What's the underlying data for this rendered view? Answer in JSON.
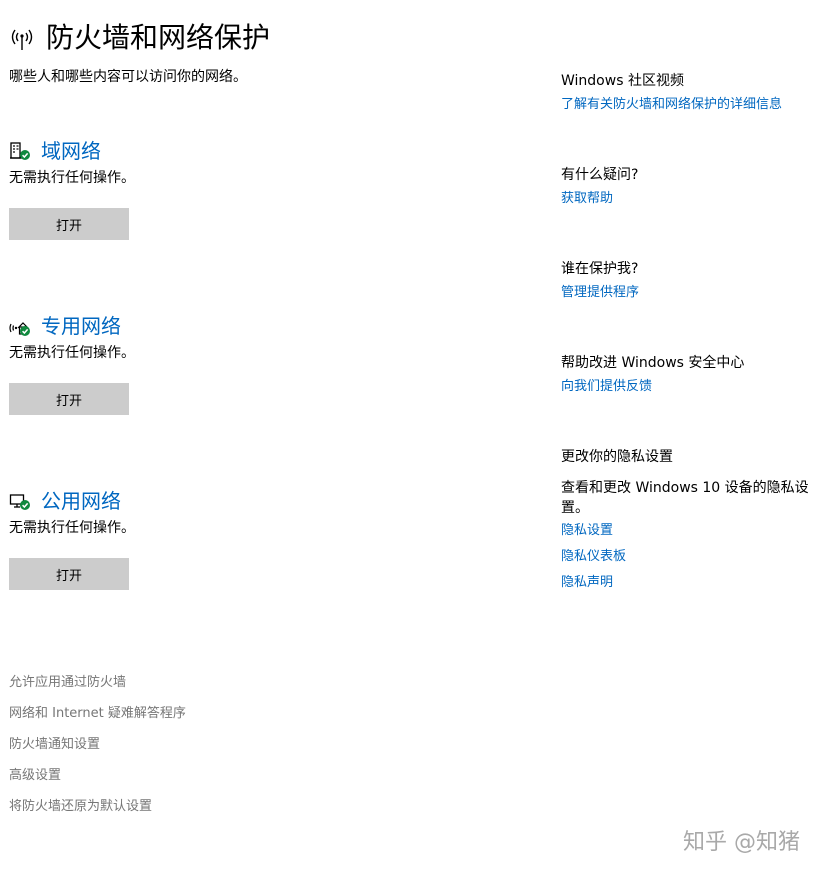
{
  "header": {
    "title": "防火墙和网络保护",
    "subtitle": "哪些人和哪些内容可以访问你的网络。",
    "icon": "wifi-antenna-icon"
  },
  "networks": [
    {
      "name": "域网络",
      "status": "无需执行任何操作。",
      "button_label": "打开",
      "icon": "domain-network-icon"
    },
    {
      "name": "专用网络",
      "status": "无需执行任何操作。",
      "button_label": "打开",
      "icon": "private-network-icon"
    },
    {
      "name": "公用网络",
      "status": "无需执行任何操作。",
      "button_label": "打开",
      "icon": "public-network-icon"
    }
  ],
  "footer_links": [
    "允许应用通过防火墙",
    "网络和 Internet 疑难解答程序",
    "防火墙通知设置",
    "高级设置",
    "将防火墙还原为默认设置"
  ],
  "sidebar": {
    "community": {
      "heading": "Windows 社区视频",
      "link": "了解有关防火墙和网络保护的详细信息"
    },
    "help": {
      "heading": "有什么疑问?",
      "link": "获取帮助"
    },
    "protector": {
      "heading": "谁在保护我?",
      "link": "管理提供程序"
    },
    "feedback": {
      "heading": "帮助改进 Windows 安全中心",
      "link": "向我们提供反馈"
    },
    "privacy": {
      "heading": "更改你的隐私设置",
      "text": "查看和更改 Windows 10 设备的隐私设置。",
      "links": [
        "隐私设置",
        "隐私仪表板",
        "隐私声明"
      ]
    }
  },
  "watermark": "知乎 @知猪",
  "colors": {
    "link": "#0067c0",
    "button_bg": "#cccccc",
    "footer_link": "#767676",
    "check_green": "#10893e"
  }
}
